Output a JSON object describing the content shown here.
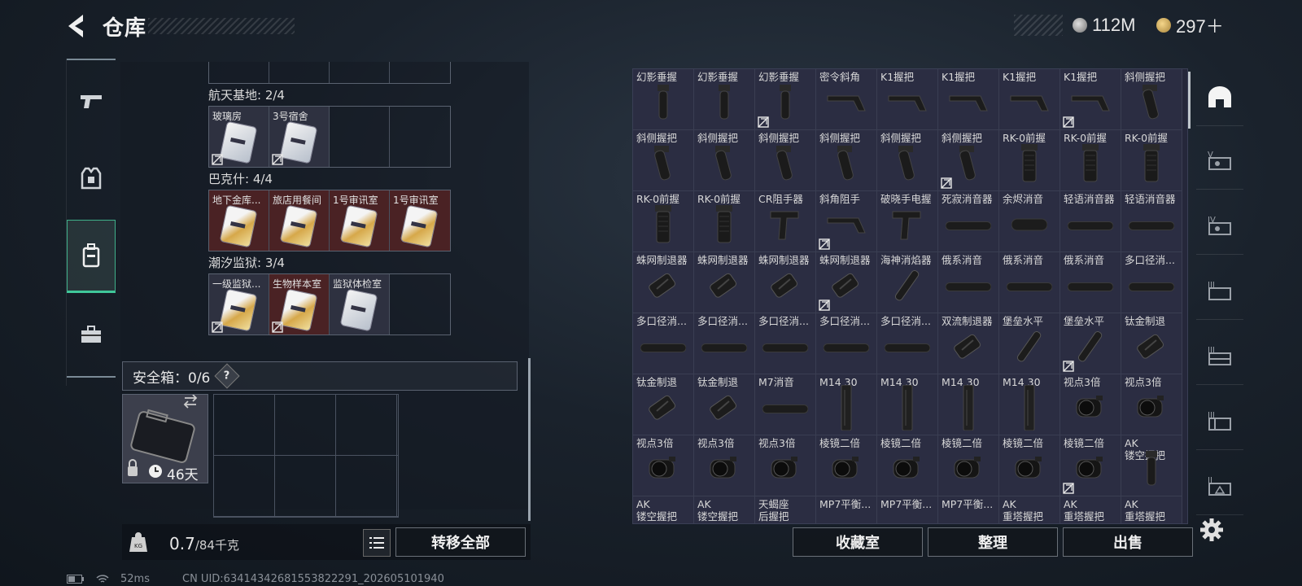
{
  "header": {
    "title": "仓库",
    "money": "112M",
    "tokens": "297＋"
  },
  "left_nav": {
    "items": [
      "weapon",
      "armor",
      "backpack",
      "toolbox"
    ],
    "active": 2
  },
  "left_panel": {
    "sections": [
      {
        "name": "航天基地: 2/4",
        "slots": [
          {
            "label": "玻璃房",
            "card": "white",
            "locked": true
          },
          {
            "label": "3号宿舍",
            "card": "white",
            "locked": true
          },
          {
            "label": "",
            "card": null,
            "locked": false
          },
          {
            "label": "",
            "card": null,
            "locked": false
          }
        ]
      },
      {
        "name": "巴克什: 4/4",
        "slots": [
          {
            "label": "地下金库...",
            "card": "gold",
            "locked": false
          },
          {
            "label": "旅店用餐间",
            "card": "gold",
            "locked": false
          },
          {
            "label": "1号审讯室",
            "card": "gold",
            "locked": false
          },
          {
            "label": "1号审讯室",
            "card": "gold",
            "locked": false
          }
        ]
      },
      {
        "name": "潮汐监狱: 3/4",
        "slots": [
          {
            "label": "一级监狱...",
            "card": "gold",
            "locked": true
          },
          {
            "label": "生物样本室",
            "card": "gold",
            "locked": true
          },
          {
            "label": "监狱体检室",
            "card": "white",
            "locked": false
          },
          {
            "label": "",
            "card": null,
            "locked": false
          }
        ]
      }
    ],
    "safe_box": {
      "label": "安全箱：0/6",
      "help": "?",
      "days": "46天"
    },
    "weight": {
      "current": "0.7",
      "max": "/84千克"
    },
    "transfer_all": "转移全部"
  },
  "right_panel": {
    "items": [
      {
        "label": "幻影垂握",
        "part": "grip-vert",
        "locked": false
      },
      {
        "label": "幻影垂握",
        "part": "grip-vert",
        "locked": false
      },
      {
        "label": "幻影垂握",
        "part": "grip-vert",
        "locked": true
      },
      {
        "label": "密令斜角",
        "part": "grip-angle",
        "locked": false
      },
      {
        "label": "K1握把",
        "part": "grip-angle",
        "locked": false
      },
      {
        "label": "K1握把",
        "part": "grip-angle",
        "locked": false
      },
      {
        "label": "K1握把",
        "part": "grip-angle",
        "locked": false
      },
      {
        "label": "K1握把",
        "part": "grip-angle",
        "locked": true
      },
      {
        "label": "斜侧握把",
        "part": "grip-slant",
        "locked": false
      },
      {
        "label": "斜侧握把",
        "part": "grip-slant",
        "locked": false
      },
      {
        "label": "斜侧握把",
        "part": "grip-slant",
        "locked": false
      },
      {
        "label": "斜侧握把",
        "part": "grip-slant",
        "locked": false
      },
      {
        "label": "斜侧握把",
        "part": "grip-slant",
        "locked": false
      },
      {
        "label": "斜侧握把",
        "part": "grip-slant",
        "locked": false
      },
      {
        "label": "斜侧握把",
        "part": "grip-slant",
        "locked": true
      },
      {
        "label": "RK-0前握",
        "part": "grip-fore",
        "locked": false
      },
      {
        "label": "RK-0前握",
        "part": "grip-fore",
        "locked": false
      },
      {
        "label": "RK-0前握",
        "part": "grip-fore",
        "locked": false
      },
      {
        "label": "RK-0前握",
        "part": "grip-fore",
        "locked": false
      },
      {
        "label": "RK-0前握",
        "part": "grip-fore",
        "locked": false
      },
      {
        "label": "CR阻手器",
        "part": "grip-stop",
        "locked": false
      },
      {
        "label": "斜角阻手",
        "part": "grip-angle",
        "locked": true
      },
      {
        "label": "破晓手电握",
        "part": "grip-stop",
        "locked": false
      },
      {
        "label": "死寂消音器",
        "part": "suppressor",
        "locked": false
      },
      {
        "label": "余烬消音",
        "part": "suppressor-short",
        "locked": false
      },
      {
        "label": "轻语消音器",
        "part": "suppressor",
        "locked": false
      },
      {
        "label": "轻语消音器",
        "part": "suppressor",
        "locked": false
      },
      {
        "label": "蛛网制退器",
        "part": "brake",
        "locked": false
      },
      {
        "label": "蛛网制退器",
        "part": "brake",
        "locked": false
      },
      {
        "label": "蛛网制退器",
        "part": "brake",
        "locked": false
      },
      {
        "label": "蛛网制退器",
        "part": "brake",
        "locked": true
      },
      {
        "label": "海神消焰器",
        "part": "flash",
        "locked": false
      },
      {
        "label": "俄系消音",
        "part": "suppressor",
        "locked": false
      },
      {
        "label": "俄系消音",
        "part": "suppressor",
        "locked": false
      },
      {
        "label": "俄系消音",
        "part": "suppressor",
        "locked": false
      },
      {
        "label": "多口径消...",
        "part": "suppressor",
        "locked": false
      },
      {
        "label": "多口径消...",
        "part": "suppressor",
        "locked": false
      },
      {
        "label": "多口径消...",
        "part": "suppressor",
        "locked": false
      },
      {
        "label": "多口径消...",
        "part": "suppressor",
        "locked": false
      },
      {
        "label": "多口径消...",
        "part": "suppressor",
        "locked": false
      },
      {
        "label": "多口径消...",
        "part": "suppressor",
        "locked": false
      },
      {
        "label": "双流制退器",
        "part": "brake",
        "locked": false
      },
      {
        "label": "堡垒水平",
        "part": "flash",
        "locked": false
      },
      {
        "label": "堡垒水平",
        "part": "flash",
        "locked": true
      },
      {
        "label": "钛金制退",
        "part": "brake",
        "locked": false
      },
      {
        "label": "钛金制退",
        "part": "brake",
        "locked": false
      },
      {
        "label": "钛金制退",
        "part": "brake",
        "locked": false
      },
      {
        "label": "M7消音",
        "part": "suppressor",
        "locked": false
      },
      {
        "label": "M14 30",
        "part": "mag",
        "locked": false
      },
      {
        "label": "M14 30",
        "part": "mag",
        "locked": false
      },
      {
        "label": "M14 30",
        "part": "mag",
        "locked": false
      },
      {
        "label": "M14 30",
        "part": "mag",
        "locked": false
      },
      {
        "label": "视点3倍",
        "part": "scope",
        "locked": false
      },
      {
        "label": "视点3倍",
        "part": "scope",
        "locked": false
      },
      {
        "label": "视点3倍",
        "part": "scope",
        "locked": false
      },
      {
        "label": "视点3倍",
        "part": "scope",
        "locked": false
      },
      {
        "label": "视点3倍",
        "part": "scope",
        "locked": false
      },
      {
        "label": "棱镜二倍",
        "part": "scope",
        "locked": false
      },
      {
        "label": "棱镜二倍",
        "part": "scope",
        "locked": false
      },
      {
        "label": "棱镜二倍",
        "part": "scope",
        "locked": false
      },
      {
        "label": "棱镜二倍",
        "part": "scope",
        "locked": false
      },
      {
        "label": "棱镜二倍",
        "part": "scope",
        "locked": true
      },
      {
        "label": "AK\n镂空握把",
        "part": "grip-vert",
        "locked": false
      },
      {
        "label": "AK\n镂空握把",
        "part": "none",
        "locked": false
      },
      {
        "label": "AK\n镂空握把",
        "part": "none",
        "locked": false
      },
      {
        "label": "天蝎座\n后握把",
        "part": "none",
        "locked": false
      },
      {
        "label": "MP7平衡...",
        "part": "none",
        "locked": false
      },
      {
        "label": "MP7平衡...",
        "part": "none",
        "locked": false
      },
      {
        "label": "MP7平衡...",
        "part": "none",
        "locked": false
      },
      {
        "label": "AK\n重塔握把",
        "part": "none",
        "locked": false
      },
      {
        "label": "AK\n重塔握把",
        "part": "none",
        "locked": false
      },
      {
        "label": "AK\n重塔握把",
        "part": "none",
        "locked": false
      }
    ],
    "buttons": {
      "collection": "收藏室",
      "sort": "整理",
      "sell": "出售"
    }
  },
  "right_rail": {
    "tabs": [
      "helmet",
      "V",
      "IV",
      "III",
      "III",
      "III",
      "II"
    ]
  },
  "status": {
    "ping": "52ms",
    "uid": "CN UID:63414342681553822291_202605101940"
  },
  "colors": {
    "accent": "#3fc89a",
    "locked_slot": "#4a2224",
    "grid_bg": "#2b2d42"
  }
}
